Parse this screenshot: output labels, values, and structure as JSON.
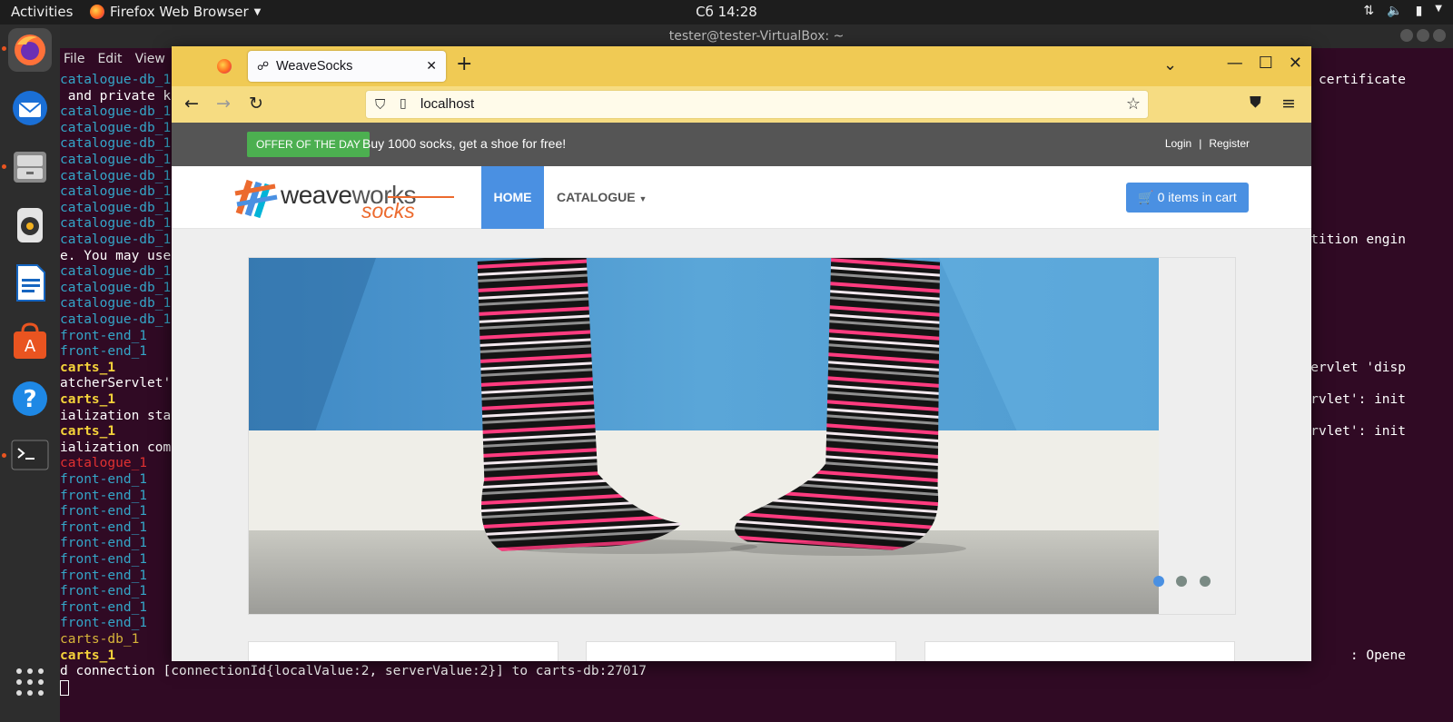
{
  "topbar": {
    "activities": "Activities",
    "app_name": "Firefox Web Browser",
    "clock": "Сб 14:28"
  },
  "terminal": {
    "title": "tester@tester-VirtualBox: ~",
    "menu": [
      "File",
      "Edit",
      "View"
    ],
    "lines": [
      {
        "text": "catalogue-db_1",
        "cls": "c-cat"
      },
      {
        "text": " and private k",
        "cls": "c-white"
      },
      {
        "text": "catalogue-db_1",
        "cls": "c-cat"
      },
      {
        "text": "catalogue-db_1",
        "cls": "c-cat"
      },
      {
        "text": "catalogue-db_1",
        "cls": "c-cat"
      },
      {
        "text": "catalogue-db_1",
        "cls": "c-cat"
      },
      {
        "text": "catalogue-db_1",
        "cls": "c-cat"
      },
      {
        "text": "catalogue-db_1",
        "cls": "c-cat"
      },
      {
        "text": "catalogue-db_1",
        "cls": "c-cat"
      },
      {
        "text": "catalogue-db_1",
        "cls": "c-cat"
      },
      {
        "text": "catalogue-db_1",
        "cls": "c-cat"
      },
      {
        "text": "e. You may use",
        "cls": "c-white"
      },
      {
        "text": "catalogue-db_1",
        "cls": "c-cat"
      },
      {
        "text": "catalogue-db_1",
        "cls": "c-cat"
      },
      {
        "text": "catalogue-db_1",
        "cls": "c-cat"
      },
      {
        "text": "catalogue-db_1",
        "cls": "c-cat"
      },
      {
        "text": "front-end_1",
        "cls": "c-fe"
      },
      {
        "text": "front-end_1",
        "cls": "c-fe"
      },
      {
        "text": "carts_1",
        "cls": "c-carts"
      },
      {
        "text": "atcherServlet'",
        "cls": "c-white"
      },
      {
        "text": "carts_1",
        "cls": "c-carts"
      },
      {
        "text": "ialization sta",
        "cls": "c-white"
      },
      {
        "text": "carts_1",
        "cls": "c-carts"
      },
      {
        "text": "ialization com",
        "cls": "c-white"
      },
      {
        "text": "catalogue_1",
        "cls": "c-red"
      },
      {
        "text": "front-end_1",
        "cls": "c-fe"
      },
      {
        "text": "front-end_1",
        "cls": "c-fe"
      },
      {
        "text": "front-end_1",
        "cls": "c-fe"
      },
      {
        "text": "front-end_1",
        "cls": "c-fe"
      },
      {
        "text": "front-end_1",
        "cls": "c-fe"
      },
      {
        "text": "front-end_1",
        "cls": "c-fe"
      },
      {
        "text": "front-end_1",
        "cls": "c-fe"
      },
      {
        "text": "front-end_1",
        "cls": "c-fe"
      },
      {
        "text": "front-end_1",
        "cls": "c-fe"
      },
      {
        "text": "front-end_1",
        "cls": "c-fe"
      },
      {
        "text": "carts-db_1",
        "cls": "c-yel"
      },
      {
        "text": "carts_1",
        "cls": "c-carts"
      },
      {
        "text": "d connection [connectionId{localValue:2, serverValue:2}] to carts-db:27017",
        "cls": "c-white"
      }
    ],
    "right_fragments": [
      {
        "text": " certificate",
        "line": 0
      },
      {
        "text": "tition engin",
        "line": 10
      },
      {
        "text": "ervlet 'disp",
        "line": 18
      },
      {
        "text": "rvlet': init",
        "line": 20
      },
      {
        "text": "rvlet': init",
        "line": 22
      },
      {
        "text": ": Opene",
        "line": 36
      }
    ]
  },
  "browser": {
    "tab_title": "WeaveSocks",
    "url": "localhost",
    "page": {
      "offer_label": "OFFER OF THE DAY",
      "offer_text": "Buy 1000 socks, get a shoe for free!",
      "login": "Login",
      "separator": "|",
      "register": "Register",
      "logo_word1": "weave",
      "logo_word2": "works",
      "logo_word3": "socks",
      "nav_home": "HOME",
      "nav_catalogue": "CATALOGUE",
      "cart": "0 items in cart"
    },
    "carousel": {
      "slides": 3,
      "active": 1
    }
  },
  "colors": {
    "accent": "#4a90e2",
    "offer_green": "#4caf50",
    "firefox_tabbar": "#f0ca54",
    "terminal_bg": "#300a24",
    "ubuntu_orange": "#e95420"
  }
}
